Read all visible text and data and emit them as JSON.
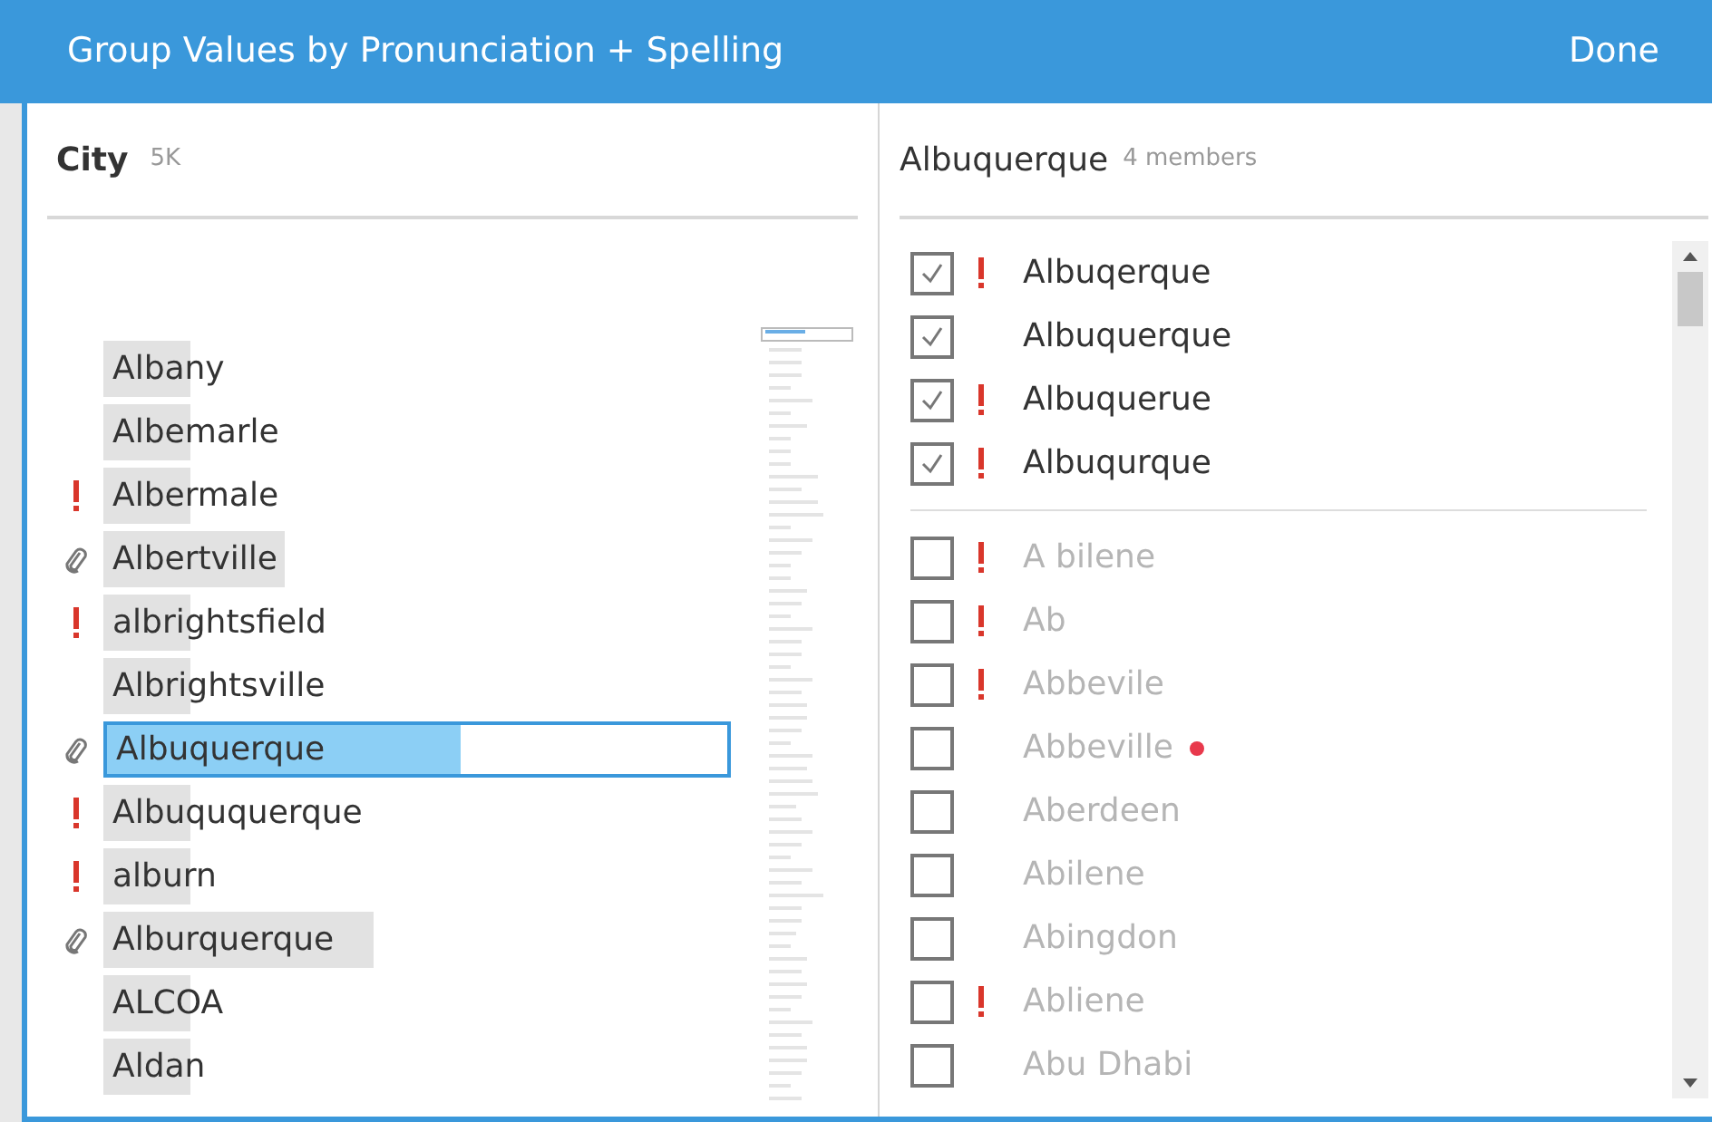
{
  "window": {
    "title": "Group Values by Pronunciation + Spelling",
    "done_button": "Done"
  },
  "left_panel": {
    "field": "City",
    "count": "5K",
    "items": [
      {
        "label": "Albany",
        "kind": "plain",
        "level": 0.14,
        "selected": false
      },
      {
        "label": "Albemarle",
        "kind": "plain",
        "level": 0.14,
        "selected": false
      },
      {
        "label": "Albermale",
        "kind": "warning",
        "level": 0.14,
        "selected": false
      },
      {
        "label": "Albertville",
        "kind": "attachment",
        "level": 0.29,
        "selected": false
      },
      {
        "label": "albrightsfield",
        "kind": "warning",
        "level": 0.14,
        "selected": false
      },
      {
        "label": "Albrightsville",
        "kind": "plain",
        "level": 0.14,
        "selected": false
      },
      {
        "label": "Albuquerque",
        "kind": "attachment",
        "level": 0.57,
        "selected": true
      },
      {
        "label": "Albuququerque",
        "kind": "warning",
        "level": 0.14,
        "selected": false
      },
      {
        "label": "alburn",
        "kind": "warning",
        "level": 0.14,
        "selected": false
      },
      {
        "label": "Alburquerque",
        "kind": "attachment",
        "level": 0.43,
        "selected": false
      },
      {
        "label": "ALCOA",
        "kind": "plain",
        "level": 0.14,
        "selected": false
      },
      {
        "label": "Aldan",
        "kind": "plain",
        "level": 0.14,
        "selected": false
      }
    ]
  },
  "right_panel": {
    "group": "Albuquerque",
    "members_count": "4 members",
    "members": [
      {
        "label": "Albuqerque",
        "checked": true,
        "warning": true
      },
      {
        "label": "Albuquerque",
        "checked": true,
        "warning": false
      },
      {
        "label": "Albuquerue",
        "checked": true,
        "warning": true
      },
      {
        "label": "Albuqurque",
        "checked": true,
        "warning": true
      }
    ],
    "others": [
      {
        "label": "A bilene",
        "checked": false,
        "warning": true,
        "dot": false
      },
      {
        "label": "Ab",
        "checked": false,
        "warning": true,
        "dot": false
      },
      {
        "label": "Abbevile",
        "checked": false,
        "warning": true,
        "dot": false
      },
      {
        "label": "Abbeville",
        "checked": false,
        "warning": false,
        "dot": true
      },
      {
        "label": "Aberdeen",
        "checked": false,
        "warning": false,
        "dot": false
      },
      {
        "label": "Abilene",
        "checked": false,
        "warning": false,
        "dot": false
      },
      {
        "label": "Abingdon",
        "checked": false,
        "warning": false,
        "dot": false
      },
      {
        "label": "Abliene",
        "checked": false,
        "warning": true,
        "dot": false
      },
      {
        "label": "Abu Dhabi",
        "checked": false,
        "warning": false,
        "dot": false
      }
    ]
  }
}
